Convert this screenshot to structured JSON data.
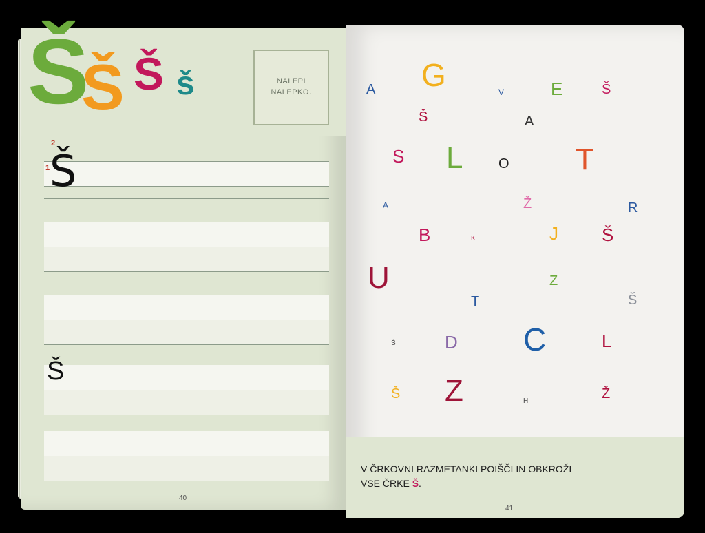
{
  "left_page": {
    "header_letters": [
      {
        "char": "Š",
        "color": "#6cab3c"
      },
      {
        "char": "Š",
        "color": "#f29a1f"
      },
      {
        "char": "Š",
        "color": "#c2185b"
      },
      {
        "char": "š",
        "color": "#1e8a8a"
      }
    ],
    "sticker_text_line1": "NALEPI",
    "sticker_text_line2": "NALEPKO.",
    "trace_letter": "Š",
    "stroke_numbers": [
      "1",
      "2"
    ],
    "copy_letter": "Š",
    "page_number": "40"
  },
  "right_page": {
    "letters": [
      {
        "char": "A",
        "color": "#2c5aa0",
        "size": "big-s"
      },
      {
        "char": "G",
        "color": "#f2b01e",
        "size": "xl"
      },
      {
        "char": "V",
        "color": "#2c5aa0",
        "size": "xs"
      },
      {
        "char": "E",
        "color": "#6cab3c",
        "size": "m"
      },
      {
        "char": "Š",
        "color": "#c2185b",
        "size": "s"
      },
      {
        "char": "Š",
        "color": "#b0123f",
        "size": "s"
      },
      {
        "char": "A",
        "color": "#333333",
        "size": "s"
      },
      {
        "char": "S",
        "color": "#c2185b",
        "size": "m"
      },
      {
        "char": "L",
        "color": "#6cab3c",
        "size": "l"
      },
      {
        "char": "O",
        "color": "#222222",
        "size": "s"
      },
      {
        "char": "T",
        "color": "#e0552b",
        "size": "l"
      },
      {
        "char": "A",
        "color": "#2c5aa0",
        "size": "xs"
      },
      {
        "char": "Ž",
        "color": "#e06aa8",
        "size": "s"
      },
      {
        "char": "R",
        "color": "#2c5aa0",
        "size": "s"
      },
      {
        "char": "B",
        "color": "#c2185b",
        "size": "m"
      },
      {
        "char": "K",
        "color": "#b0123f",
        "size": "xxs"
      },
      {
        "char": "J",
        "color": "#f2b01e",
        "size": "m"
      },
      {
        "char": "Š",
        "color": "#b0123f",
        "size": "m"
      },
      {
        "char": "U",
        "color": "#9e1438",
        "size": "l"
      },
      {
        "char": "Z",
        "color": "#6cab3c",
        "size": "s"
      },
      {
        "char": "T",
        "color": "#2c5aa0",
        "size": "s"
      },
      {
        "char": "Š",
        "color": "#8a8f98",
        "size": "s"
      },
      {
        "char": "Š",
        "color": "#444444",
        "size": "xxs"
      },
      {
        "char": "D",
        "color": "#8a6aa8",
        "size": "m"
      },
      {
        "char": "C",
        "color": "#1f5fa8",
        "size": "xl"
      },
      {
        "char": "L",
        "color": "#b0123f",
        "size": "m"
      },
      {
        "char": "Š",
        "color": "#f2b01e",
        "size": "s"
      },
      {
        "char": "Z",
        "color": "#9e1438",
        "size": "l"
      },
      {
        "char": "H",
        "color": "#444444",
        "size": "xxs"
      },
      {
        "char": "Ž",
        "color": "#b0123f",
        "size": "s"
      }
    ],
    "instruction_line1": "V ČRKOVNI RAZMETANKI POIŠČI IN OBKROŽI",
    "instruction_line2_prefix": "VSE ČRKE ",
    "instruction_highlight": "Š",
    "instruction_line2_suffix": ".",
    "page_number": "41"
  }
}
